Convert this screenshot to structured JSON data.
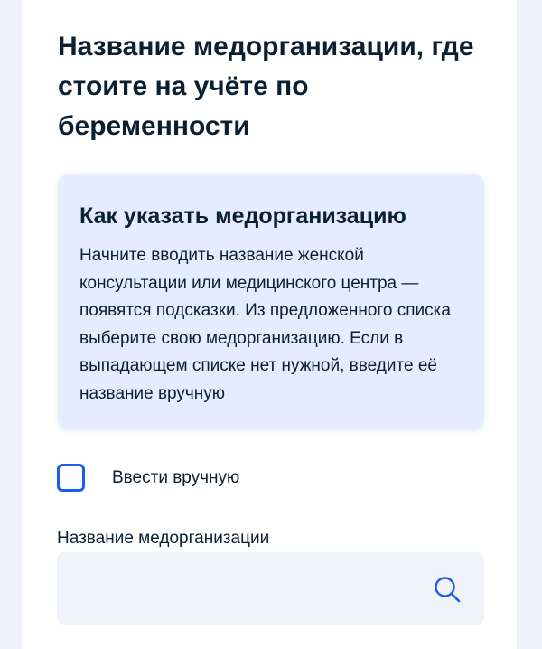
{
  "page": {
    "title": "Название медорганизации, где стоите на учёте по беременности"
  },
  "info": {
    "title": "Как указать медорганизацию",
    "text": "Начните вводить название женской консультации или медицинского центра — появятся подсказки. Из предложенного списка выберите свою медорганизацию. Если в выпадающем списке нет нужной, введите её название вручную"
  },
  "manual_entry": {
    "label": "Ввести вручную",
    "checked": false
  },
  "search": {
    "label": "Название медорганизации",
    "value": "",
    "placeholder": "",
    "icon": "search-icon"
  },
  "colors": {
    "accent": "#1d5deb",
    "text": "#0b1f33",
    "info_background": "#e4ecfd",
    "field_background": "#f0f3f8"
  }
}
